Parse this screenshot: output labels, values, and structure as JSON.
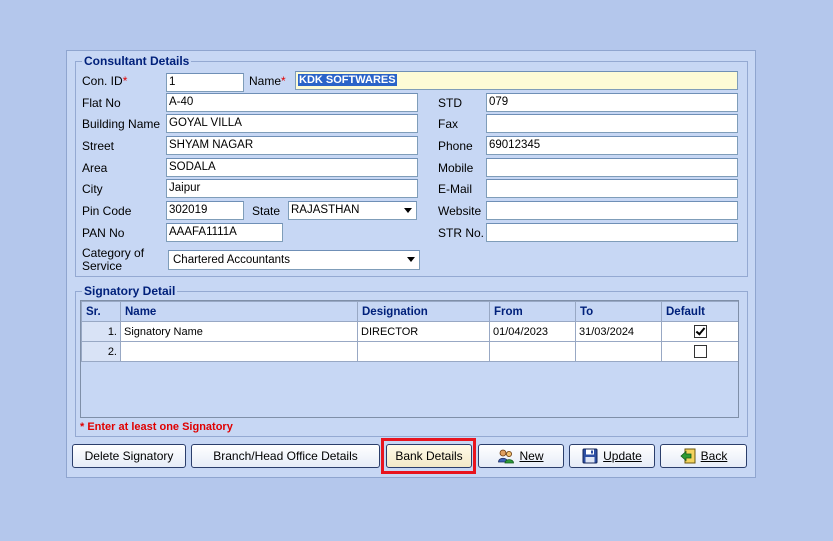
{
  "consultant": {
    "legend": "Consultant Details",
    "con_id_label": "Con. ID",
    "con_id_value": "1",
    "name_label": "Name",
    "name_value": "KDK SOFTWARES",
    "required_mark": "*",
    "flat_no_label": "Flat No",
    "flat_no_value": "A-40",
    "building_label": "Building Name",
    "building_value": "GOYAL VILLA",
    "street_label": "Street",
    "street_value": "SHYAM NAGAR",
    "area_label": "Area",
    "area_value": "SODALA",
    "city_label": "City",
    "city_value": "Jaipur",
    "pin_label": "Pin Code",
    "pin_value": "302019",
    "state_label": "State",
    "state_value": "RAJASTHAN",
    "pan_label": "PAN No",
    "pan_value": "AAAFA1111A",
    "category_label_1": "Category of",
    "category_label_2": "Service",
    "category_value": "Chartered Accountants",
    "std_label": "STD",
    "std_value": "079",
    "fax_label": "Fax",
    "fax_value": "",
    "phone_label": "Phone",
    "phone_value": "69012345",
    "mobile_label": "Mobile",
    "mobile_value": "",
    "email_label": "E-Mail",
    "email_value": "",
    "website_label": "Website",
    "website_value": "",
    "str_label": "STR No.",
    "str_value": ""
  },
  "signatory": {
    "legend": "Signatory Detail",
    "columns": [
      "Sr.",
      "Name",
      "Designation",
      "From",
      "To",
      "Default"
    ],
    "rows": [
      {
        "sr": "1.",
        "name": "Signatory Name",
        "designation": "DIRECTOR",
        "from": "01/04/2023",
        "to": "31/03/2024",
        "default": true
      },
      {
        "sr": "2.",
        "name": "",
        "designation": "",
        "from": "",
        "to": "",
        "default": false
      }
    ],
    "warning": "* Enter at least one Signatory"
  },
  "buttons": {
    "delete_signatory": "Delete Signatory",
    "branch_details": "Branch/Head Office Details",
    "bank_details": "Bank Details",
    "new": "New",
    "update": "Update",
    "back": "Back"
  },
  "colors": {
    "background": "#b4c7ec",
    "panel": "#c7d7f4",
    "legend_text": "#00207a",
    "warning_text": "#e00000",
    "highlight_border": "#e8141e",
    "name_field_bg": "#fdfbd6"
  },
  "icons": {
    "new": "users-icon",
    "update": "floppy-disk-icon",
    "back": "back-arrow-icon",
    "dropdown": "chevron-down-icon"
  }
}
